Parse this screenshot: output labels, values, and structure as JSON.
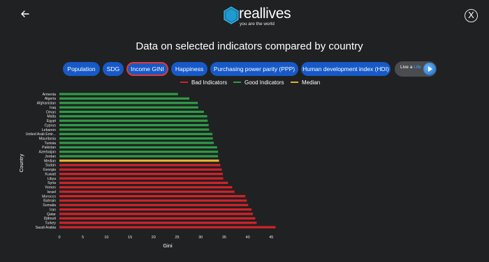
{
  "header": {
    "logo_name": "reallives",
    "logo_tagline": "you are the world",
    "close_label": "X"
  },
  "page_title": "Data on selected indicators compared by country",
  "tabs": [
    {
      "label": "Population",
      "active": false
    },
    {
      "label": "SDG",
      "active": false
    },
    {
      "label": "Income GINI",
      "active": true
    },
    {
      "label": "Happiness",
      "active": false
    },
    {
      "label": "Purchasing power parity (PPP)",
      "active": false
    },
    {
      "label": "Human development index (HDI)",
      "active": false
    }
  ],
  "live_button": {
    "prefix": "Live a ",
    "highlight": "Life"
  },
  "colors": {
    "bad": "#d3222a",
    "good": "#2e9c46",
    "median": "#e3b12c",
    "tab": "#1759c7",
    "background": "#202122"
  },
  "chart_data": {
    "type": "bar",
    "orientation": "horizontal",
    "xlabel": "Gini",
    "ylabel": "Country",
    "xlim": [
      0,
      46
    ],
    "xticks": [
      0,
      5,
      10,
      15,
      20,
      25,
      30,
      35,
      40,
      45
    ],
    "legend": [
      {
        "name": "Bad Indicators",
        "color": "#d3222a"
      },
      {
        "name": "Good Indicators",
        "color": "#2e9c46"
      },
      {
        "name": "Median",
        "color": "#e3b12c"
      }
    ],
    "legend_position": "top",
    "grid": false,
    "bars": [
      {
        "country": "Armenia",
        "value": 25.2,
        "group": "good"
      },
      {
        "country": "Algeria",
        "value": 27.6,
        "group": "good"
      },
      {
        "country": "Afghanistan",
        "value": 29.4,
        "group": "good"
      },
      {
        "country": "Iraq",
        "value": 29.5,
        "group": "good"
      },
      {
        "country": "Oman",
        "value": 30.7,
        "group": "good"
      },
      {
        "country": "Malta",
        "value": 31.4,
        "group": "good"
      },
      {
        "country": "Egypt",
        "value": 31.5,
        "group": "good"
      },
      {
        "country": "Cyprus",
        "value": 31.7,
        "group": "good"
      },
      {
        "country": "Lebanon",
        "value": 31.8,
        "group": "good"
      },
      {
        "country": "United Arab Emir...",
        "value": 32.5,
        "group": "good"
      },
      {
        "country": "Mauritania",
        "value": 32.6,
        "group": "good"
      },
      {
        "country": "Tunisia",
        "value": 32.8,
        "group": "good"
      },
      {
        "country": "Pakistan",
        "value": 33.5,
        "group": "good"
      },
      {
        "country": "Azerbaijan",
        "value": 33.7,
        "group": "good"
      },
      {
        "country": "Jordan",
        "value": 33.7,
        "group": "good"
      },
      {
        "country": "Median",
        "value": 33.9,
        "group": "median"
      },
      {
        "country": "Sudan",
        "value": 34.2,
        "group": "bad"
      },
      {
        "country": "Georgia",
        "value": 34.5,
        "group": "bad"
      },
      {
        "country": "Kuwait",
        "value": 34.7,
        "group": "bad"
      },
      {
        "country": "Libya",
        "value": 34.8,
        "group": "bad"
      },
      {
        "country": "Syria",
        "value": 35.8,
        "group": "bad"
      },
      {
        "country": "Yemen",
        "value": 36.7,
        "group": "bad"
      },
      {
        "country": "Israel",
        "value": 37.2,
        "group": "bad"
      },
      {
        "country": "Morocco",
        "value": 39.5,
        "group": "bad"
      },
      {
        "country": "Bahrain",
        "value": 39.8,
        "group": "bad"
      },
      {
        "country": "Somalia",
        "value": 40.1,
        "group": "bad"
      },
      {
        "country": "Iran",
        "value": 40.8,
        "group": "bad"
      },
      {
        "country": "Qatar",
        "value": 41.1,
        "group": "bad"
      },
      {
        "country": "Djibouti",
        "value": 41.6,
        "group": "bad"
      },
      {
        "country": "Turkey",
        "value": 41.9,
        "group": "bad"
      },
      {
        "country": "Saudi Arabia",
        "value": 45.9,
        "group": "bad"
      }
    ]
  }
}
